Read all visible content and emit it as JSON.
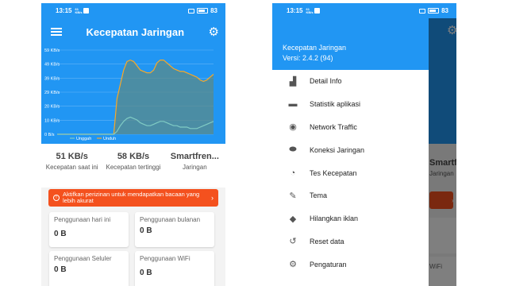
{
  "status_bar": {
    "time": "13:15",
    "net_top": "61",
    "net_bottom": "KB/s",
    "battery": "83"
  },
  "app": {
    "title": "Kecepatan Jaringan"
  },
  "chart_data": {
    "type": "line",
    "y_ticks": [
      "59 KB/s",
      "49 KB/s",
      "39 KB/s",
      "29 KB/s",
      "20 KB/s",
      "10 KB/s",
      "0 B/s"
    ],
    "ylim": [
      0,
      59
    ],
    "series": [
      {
        "name": "Unduh",
        "color": "#f9a825",
        "values": [
          0,
          0,
          0,
          0,
          0,
          0,
          0,
          0,
          0,
          0,
          0,
          0,
          0,
          0,
          0,
          0,
          0,
          0,
          25,
          35,
          45,
          51,
          52,
          51,
          48,
          45,
          44,
          43,
          43,
          45,
          50,
          52,
          52,
          50,
          48,
          46,
          45,
          44,
          44,
          43,
          42,
          41,
          40,
          38,
          37,
          38,
          40,
          42
        ]
      },
      {
        "name": "Unggah",
        "color": "#80cbc4",
        "values": [
          0,
          0,
          0,
          0,
          0,
          0,
          0,
          0,
          0,
          0,
          0,
          0,
          0,
          0,
          0,
          0,
          0,
          0,
          2,
          6,
          9,
          11,
          12,
          11,
          10,
          8,
          7,
          6,
          6,
          7,
          8,
          9,
          9,
          8,
          7,
          6,
          6,
          5,
          5,
          5,
          4,
          4,
          4,
          5,
          6,
          7,
          8,
          9
        ]
      }
    ]
  },
  "stats": [
    {
      "value": "51 KB/s",
      "label": "Kecepatan saat ini"
    },
    {
      "value": "58 KB/s",
      "label": "Kecepatan tertinggi"
    },
    {
      "value": "Smartfren...",
      "label": "Jaringan"
    }
  ],
  "alert": {
    "text": "Aktifkan perizinan untuk mendapatkan bacaan yang lebih akurat"
  },
  "cards": {
    "today": {
      "label": "Penggunaan hari ini",
      "value": "0 B"
    },
    "monthly": {
      "label": "Penggunaan bulanan",
      "value": "0 B"
    },
    "cellular": {
      "label": "Penggunaan Seluler",
      "value": "0 B"
    },
    "wifi": {
      "label": "Penggunaan WiFi",
      "value": "0 B"
    }
  },
  "drawer": {
    "app_name": "Kecepatan Jaringan",
    "version": "Versi: 2.4.2 (94)",
    "items": [
      {
        "label": "Detail Info",
        "icon": "bar-chart-icon",
        "glyph": "▟"
      },
      {
        "label": "Statistik aplikasi",
        "icon": "app-stats-icon",
        "glyph": "▬"
      },
      {
        "label": "Network Traffic",
        "icon": "network-traffic-icon",
        "glyph": "◉"
      },
      {
        "label": "Koneksi Jaringan",
        "icon": "connection-icon",
        "glyph": "⬬"
      },
      {
        "label": "Tes Kecepatan",
        "icon": "speedometer-icon",
        "glyph": "◔"
      },
      {
        "label": "Tema",
        "icon": "brush-icon",
        "glyph": "✎"
      },
      {
        "label": "Hilangkan iklan",
        "icon": "tag-icon",
        "glyph": "◆"
      },
      {
        "label": "Reset data",
        "icon": "reset-icon",
        "glyph": "↺"
      },
      {
        "label": "Pengaturan",
        "icon": "gear-icon",
        "glyph": "⚙"
      }
    ]
  },
  "background": {
    "stat_partial": "Smartfren...",
    "stat_label_partial": "Jaringan",
    "card_partial": "WiFi"
  }
}
